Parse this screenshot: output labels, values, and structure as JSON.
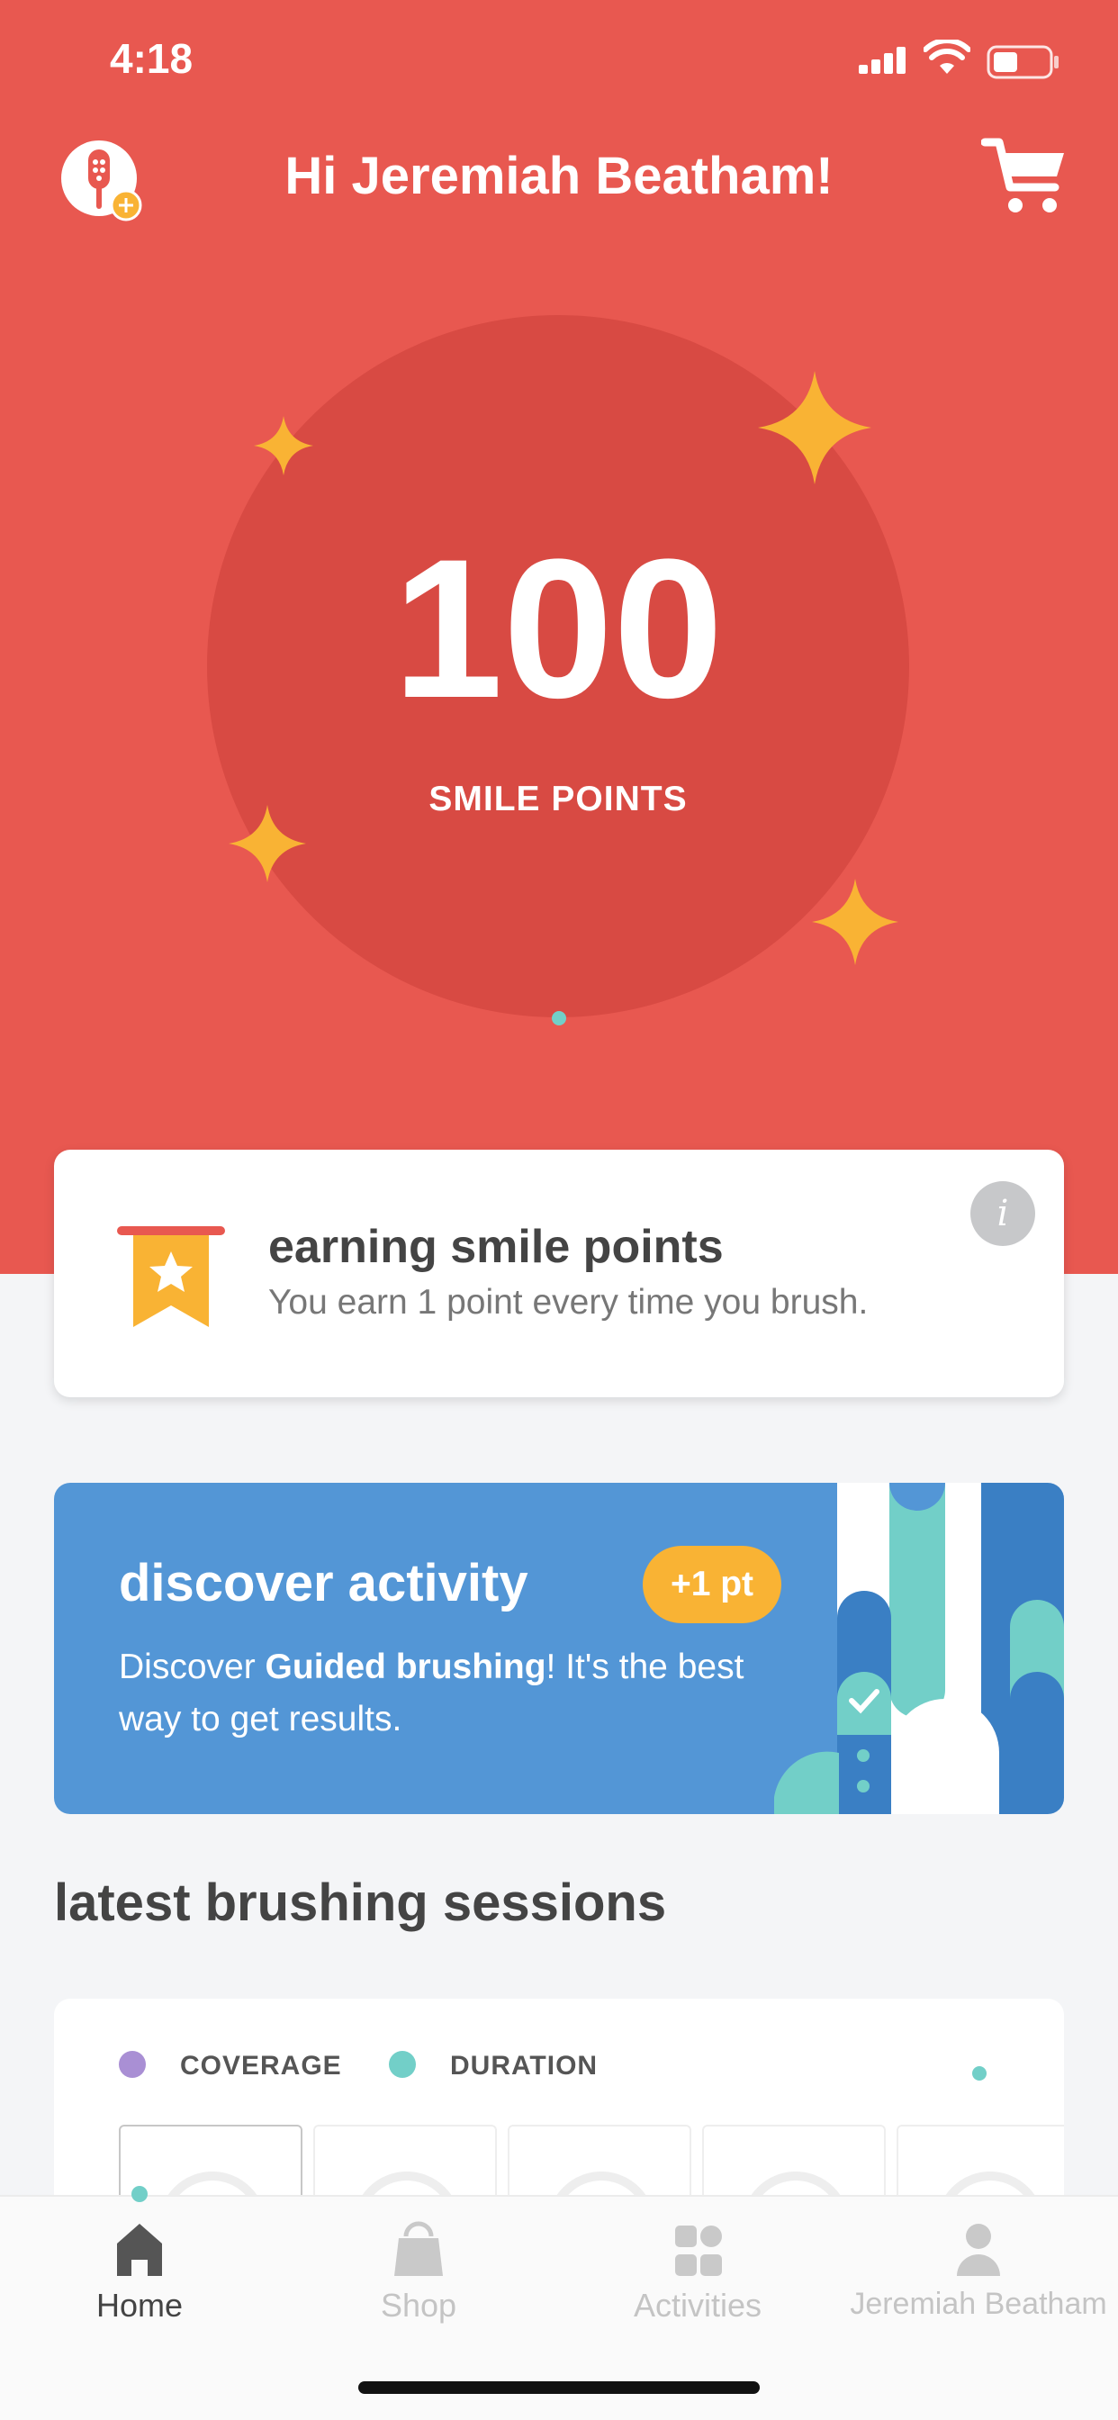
{
  "status_bar": {
    "time": "4:18"
  },
  "header": {
    "greeting": "Hi Jeremiah Beatham!"
  },
  "points": {
    "value": "100",
    "label": "SMILE POINTS"
  },
  "earning_card": {
    "title": "earning smile points",
    "text": "You earn 1 point every time you brush.",
    "info_icon": "i"
  },
  "activity_card": {
    "title": "discover activity",
    "badge": "+1 pt",
    "text_before": "Discover ",
    "text_bold": "Guided brushing",
    "text_after": "! It's the best way to get results."
  },
  "sessions": {
    "title": "latest brushing sessions",
    "legend": [
      {
        "label": "COVERAGE",
        "color": "#a98fd4"
      },
      {
        "label": "DURATION",
        "color": "#72cfc8"
      }
    ]
  },
  "tabbar": {
    "tabs": [
      {
        "label": "Home",
        "icon": "home-icon",
        "active": true
      },
      {
        "label": "Shop",
        "icon": "shopping-bag-icon",
        "active": false
      },
      {
        "label": "Activities",
        "icon": "grid-icon",
        "active": false
      },
      {
        "label": "Jeremiah Beatham",
        "icon": "person-icon",
        "active": false
      }
    ]
  },
  "colors": {
    "hero": "#e85850",
    "circle": "#d84a43",
    "sparkle": "#f9b334",
    "activity_card": "#5396d6",
    "accent": "#72cfc8"
  }
}
